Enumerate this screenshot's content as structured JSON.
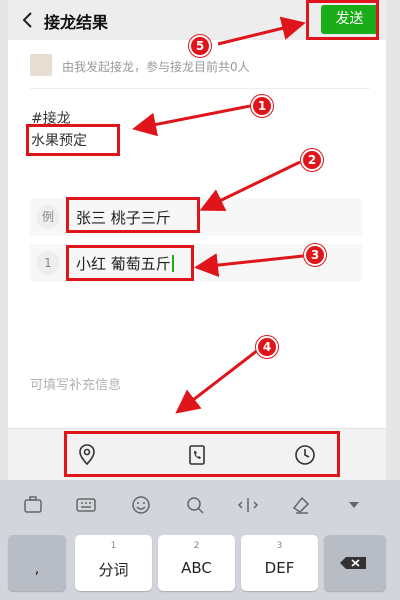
{
  "header": {
    "title": "接龙结果",
    "send_label": "发送"
  },
  "info": {
    "text": "由我发起接龙，参与接龙目前共0人"
  },
  "content": {
    "tag": "#接龙",
    "subject": "水果预定"
  },
  "entries": [
    {
      "num": "例",
      "text": "张三 桃子三斤"
    },
    {
      "num": "1",
      "text": "小红 葡萄五斤"
    }
  ],
  "supplement_placeholder": "可填写补充信息",
  "keyboard": {
    "keys": [
      {
        "num": "",
        "label": ","
      },
      {
        "num": "1",
        "label": "分词"
      },
      {
        "num": "2",
        "label": "ABC"
      },
      {
        "num": "3",
        "label": "DEF"
      }
    ]
  },
  "annotations": {
    "badges": [
      "1",
      "2",
      "3",
      "4",
      "5"
    ]
  },
  "colors": {
    "accent": "#1aad19",
    "annotation": "#e0151b"
  }
}
